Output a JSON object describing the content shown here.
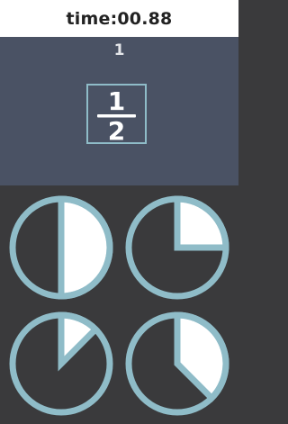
{
  "header": {
    "timer": "time:00.88"
  },
  "question": {
    "level": "1",
    "numerator": "1",
    "denominator": "2"
  },
  "options": [
    {
      "fraction": 0.5
    },
    {
      "fraction": 0.25
    },
    {
      "fraction": 0.125
    },
    {
      "fraction": 0.375
    }
  ],
  "colors": {
    "ring": "#8fbcc8",
    "fill": "#ffffff",
    "empty": "#3a3a3c",
    "panel": "#4a5264"
  },
  "icons": [
    "pie-option-icon"
  ]
}
